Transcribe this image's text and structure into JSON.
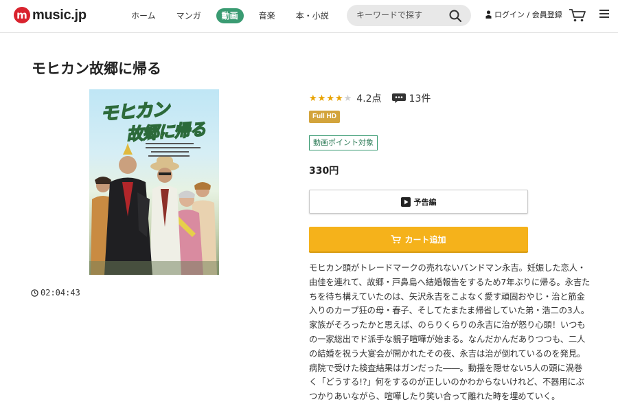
{
  "header": {
    "logo_text": "music.jp",
    "nav": [
      {
        "label": "ホーム",
        "active": false
      },
      {
        "label": "マンガ",
        "active": false
      },
      {
        "label": "動画",
        "active": true
      },
      {
        "label": "音楽",
        "active": false
      },
      {
        "label": "本・小説",
        "active": false
      }
    ],
    "search_placeholder": "キーワードで探す",
    "login_label": "ログイン / 会員登録"
  },
  "title": {
    "text": "モヒカン故郷に帰る"
  },
  "poster": {
    "title_line1": "モヒカン",
    "title_line2": "故郷に帰る"
  },
  "duration": "02:04:43",
  "rating": {
    "stars_filled": 4,
    "stars_total": 5,
    "score": "4.2点",
    "review_count": "13件",
    "star_color": "#e8a200"
  },
  "badges": {
    "quality": "Full HD",
    "points": "動画ポイント対象"
  },
  "price": "330円",
  "buttons": {
    "trailer": "予告編",
    "cart": "カート追加"
  },
  "synopsis": "モヒカン頭がトレードマークの売れないバンドマン永吉。妊娠した恋人・由佳を連れて、故郷・戸鼻島へ結婚報告をするため7年ぶりに帰る。永吉たちを待ち構えていたのは、矢沢永吉をこよなく愛す頑固おやじ・治と筋金入りのカープ狂の母・春子、そしてたまたま帰省していた弟・浩二の3人。家族がそろったかと思えば、のらりくらりの永吉に治が怒り心頭！いつもの一家総出でド派手な親子喧嘩が始まる。なんだかんだありつつも、二人の結婚を祝う大宴会が開かれたその夜、永吉は治が倒れているのを発見。病院で受けた検査結果はガンだった――。動揺を隠せない5人の頭に渦巻く「どうする!?」何をするのが正しいのかわからないけれど、不器用にぶつかりあいながら、喧嘩したり笑い合って離れた時を埋めていく。",
  "colors": {
    "accent_green": "#3a9b72",
    "cart_yellow": "#f5b21b",
    "hd_badge": "#d3a43c",
    "logo_red": "#d9232e"
  }
}
